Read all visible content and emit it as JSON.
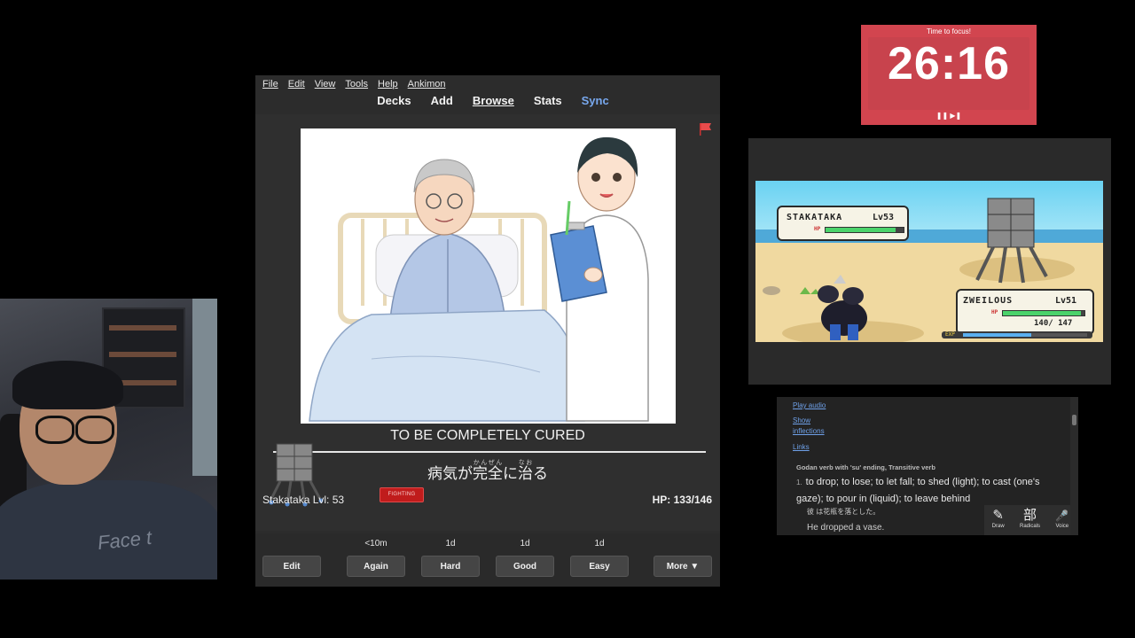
{
  "webcam": {
    "shirt_text": "Face t"
  },
  "anki": {
    "menu": [
      "File",
      "Edit",
      "View",
      "Tools",
      "Help",
      "Ankimon"
    ],
    "toolbar": {
      "decks": "Decks",
      "add": "Add",
      "browse": "Browse",
      "stats": "Stats",
      "sync": "Sync"
    },
    "card": {
      "answer": "TO BE COMPLETELY CURED",
      "reading": {
        "byouki": "病気",
        "byouki_rt": "",
        "ga": "が",
        "kan": "完",
        "kan_rt": "かん",
        "zen": "全",
        "zen_rt": "ぜん",
        "ni": "に",
        "nao": "治",
        "nao_rt": "なお",
        "ru": "る"
      }
    },
    "battle": {
      "monster_label": "Stakataka Lvl: 53",
      "type": "FIGHTING",
      "hp": "HP: 133/146"
    },
    "buttons": [
      {
        "label": "Edit",
        "interval": ""
      },
      {
        "label": "Again",
        "interval": "<10m"
      },
      {
        "label": "Hard",
        "interval": "1d"
      },
      {
        "label": "Good",
        "interval": "1d"
      },
      {
        "label": "Easy",
        "interval": "1d"
      },
      {
        "label": "More ▼",
        "interval": ""
      }
    ],
    "flag_color": "#e84b4b"
  },
  "timer": {
    "title": "Time to focus!",
    "time": "26:16",
    "controls": "❚❚ ▶❚"
  },
  "game": {
    "enemy": {
      "name": "STAKATAKA",
      "level": "Lv53",
      "hp_label": "HP",
      "hp_fraction": 0.9
    },
    "player": {
      "name": "ZWEILOUS",
      "level": "Lv51",
      "hp_label": "HP",
      "hp_fraction": 0.96,
      "hp_text": "140/ 147",
      "exp_label": "EXP",
      "exp_fraction": 0.55
    }
  },
  "dictionary": {
    "play_audio": "Play audio",
    "show": "Show",
    "inflections": "inflections",
    "links": "Links",
    "pos": "Godan verb with 'su' ending, Transitive verb",
    "def_num": "1.",
    "definition": "to drop; to lose; to let fall; to shed (light); to cast (one's gaze); to pour in (liquid); to leave behind",
    "example_jp": "彼 は花瓶を落とした。",
    "example_en": "He dropped a vase.",
    "tools": [
      {
        "glyph": "✎",
        "label": "Draw"
      },
      {
        "glyph": "部",
        "label": "Radicals"
      },
      {
        "glyph": "🎤",
        "label": "Voice"
      }
    ]
  }
}
